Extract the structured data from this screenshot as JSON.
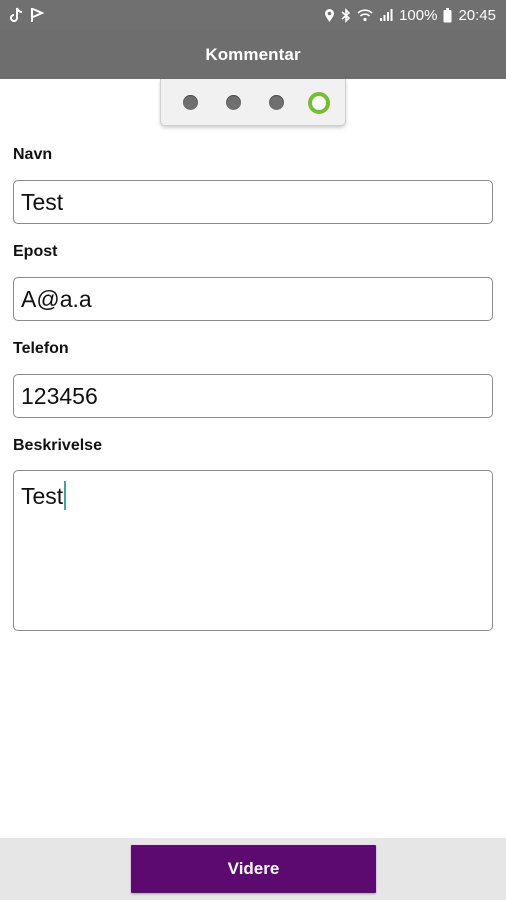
{
  "status_bar": {
    "battery": "100%",
    "time": "20:45",
    "icons": [
      "tiktok-icon",
      "flag-icon",
      "location-icon",
      "bluetooth-icon",
      "wifi-icon",
      "signal-icon",
      "battery-icon"
    ]
  },
  "header": {
    "title": "Kommentar"
  },
  "stepper": {
    "total_steps": 4,
    "current_step": 4,
    "active_color": "#72c02c"
  },
  "form": {
    "name": {
      "label": "Navn",
      "value": "Test"
    },
    "email": {
      "label": "Epost",
      "value": "A@a.a"
    },
    "phone": {
      "label": "Telefon",
      "value": "123456"
    },
    "description": {
      "label": "Beskrivelse",
      "value": "Test"
    }
  },
  "footer": {
    "next_label": "Videre"
  },
  "colors": {
    "app_bar": "#6e6e6e",
    "primary": "#5c0a6f",
    "footer_bg": "#e6e6e6"
  }
}
